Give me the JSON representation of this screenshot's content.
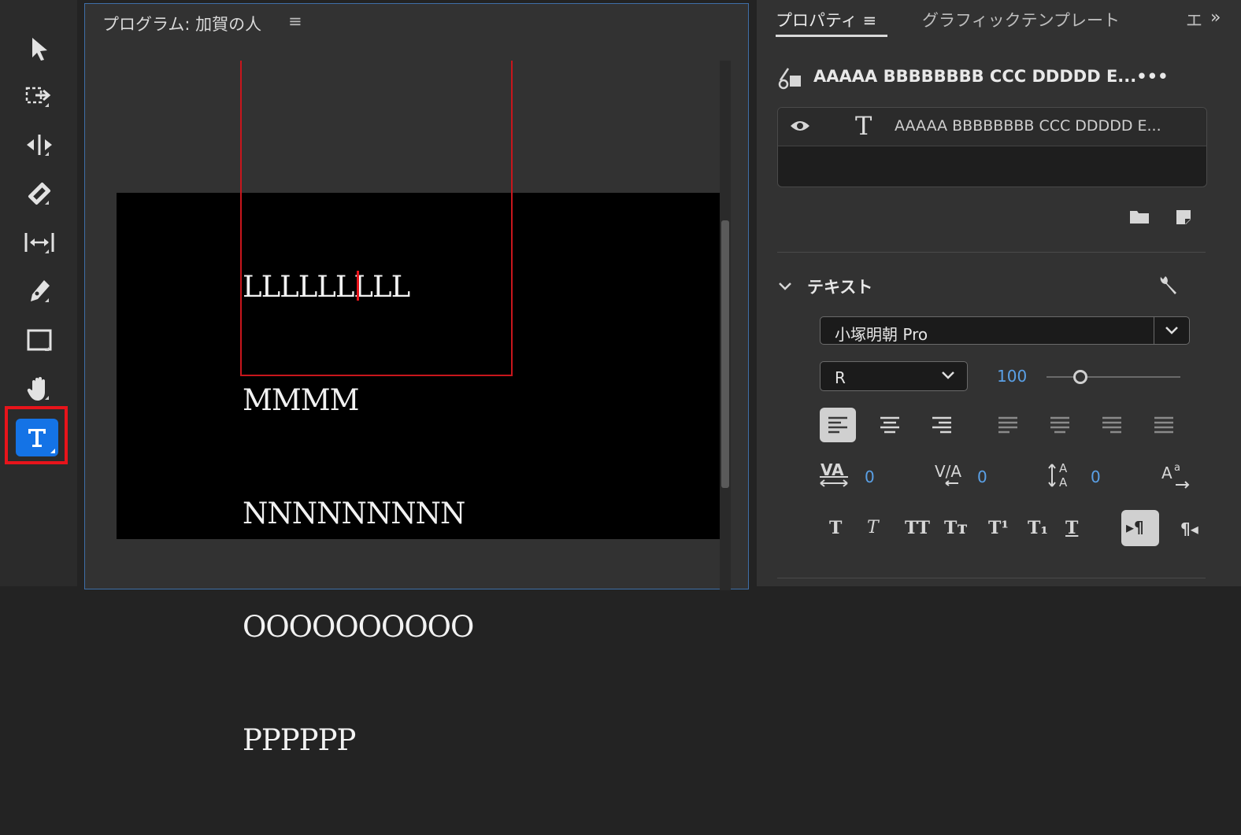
{
  "program_monitor": {
    "title": "プログラム: 加賀の人",
    "menu_icon": "≡",
    "text_lines": [
      "LLLLLLLLL",
      "MMMM",
      "NNNNNNNNN",
      "OOOOOOOOOO",
      "PPPPPP"
    ]
  },
  "properties": {
    "tabs": [
      {
        "label": "プロパティ",
        "menu_icon": "≡",
        "active": true
      },
      {
        "label": "グラフィックテンプレート",
        "active": false
      },
      {
        "label": "エ",
        "active": false
      }
    ],
    "more_icon": "»",
    "clip_title": "AAAAA BBBBBBBB CCC DDDDD E...",
    "clip_more": "•••",
    "layer": {
      "type_glyph": "T",
      "name": "AAAAA BBBBBBBB CCC DDDDD E..."
    },
    "text_section": {
      "heading": "テキスト",
      "font_family": "小塚明朝 Pro",
      "font_style": "R",
      "font_size": "100",
      "font_size_level": 0.25,
      "tracking_kerning": [
        "0",
        "0",
        "0"
      ],
      "format_glyphs": {
        "bold": "T",
        "italic": "T",
        "caps": "TT",
        "small_caps": "Tт",
        "superscript": "T¹",
        "subscript": "T₁",
        "underline": "T",
        "ltr": "▸¶",
        "rtl": "¶◂"
      }
    }
  },
  "colors": {
    "accent": "#1473e6",
    "highlight_red": "#e8141b",
    "value_blue": "#5aa0e6"
  }
}
